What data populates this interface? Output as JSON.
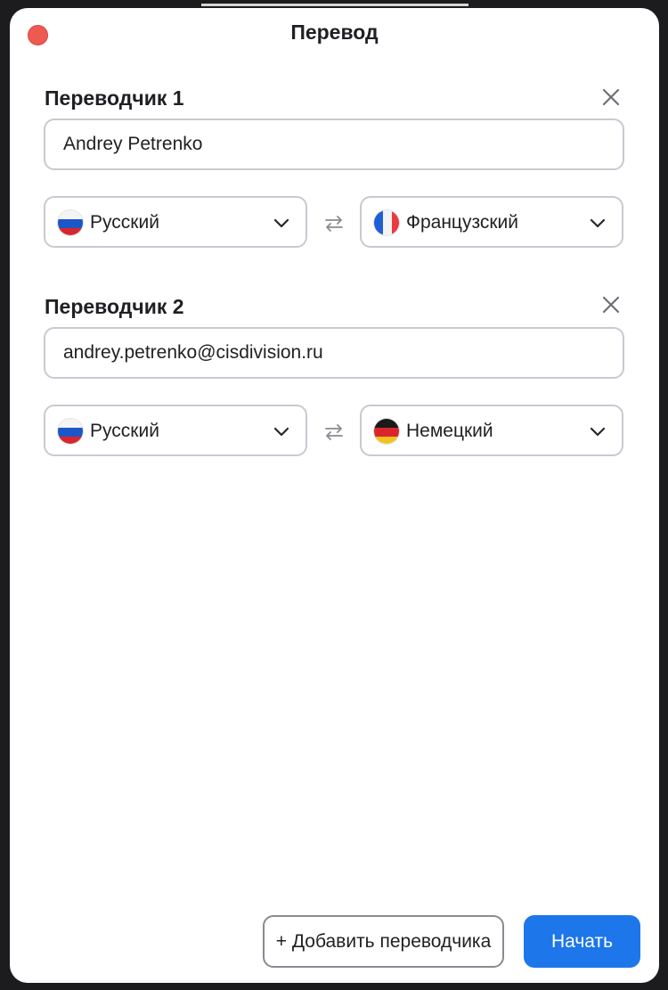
{
  "window": {
    "title": "Перевод"
  },
  "translators": [
    {
      "heading": "Переводчик 1",
      "name_value": "Andrey Petrenko",
      "source_lang": {
        "label": "Русский",
        "flag": "flag-russia"
      },
      "target_lang": {
        "label": "Французский",
        "flag": "flag-france"
      }
    },
    {
      "heading": "Переводчик 2",
      "name_value": "andrey.petrenko@cisdivision.ru",
      "source_lang": {
        "label": "Русский",
        "flag": "flag-russia"
      },
      "target_lang": {
        "label": "Немецкий",
        "flag": "flag-germany"
      }
    }
  ],
  "actions": {
    "add_translator_label": "+ Добавить переводчика",
    "start_label": "Начать"
  },
  "colors": {
    "primary": "#1d76ea",
    "close_dot": "#ee5a52",
    "border": "#c9c9d1"
  },
  "icons": {
    "close_window": "close-dot-icon",
    "remove": "close-x-icon",
    "swap": "swap-arrows-icon",
    "dropdown": "chevron-down-icon"
  }
}
